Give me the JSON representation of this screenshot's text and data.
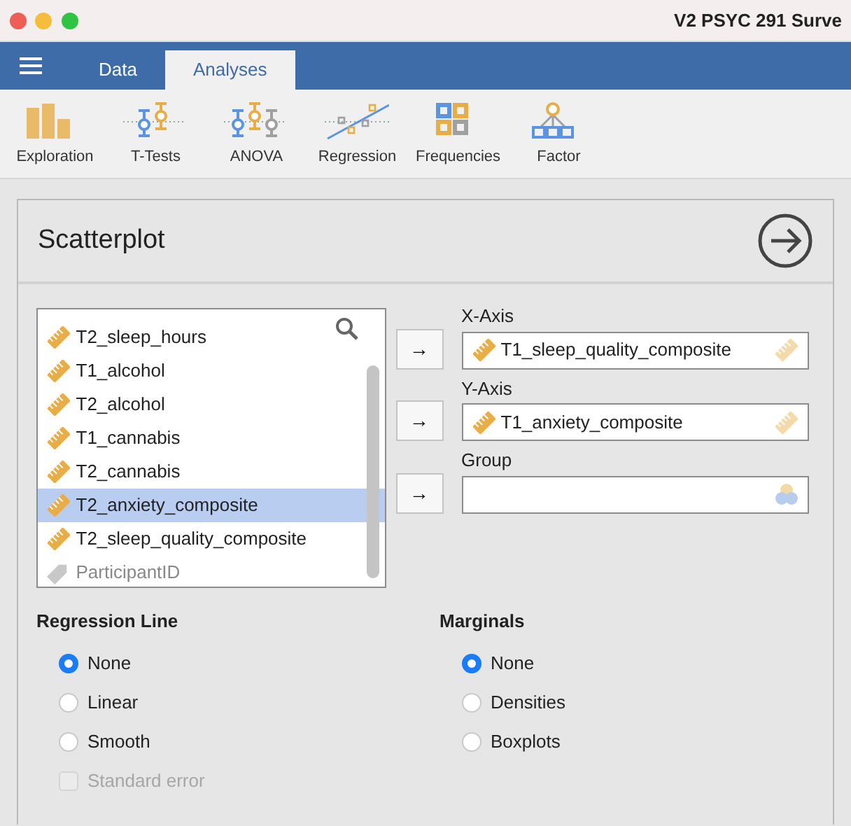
{
  "window": {
    "title": "V2 PSYC 291 Surve"
  },
  "tabs": [
    {
      "label": "Data",
      "selected": false
    },
    {
      "label": "Analyses",
      "selected": true
    }
  ],
  "toolbar": [
    {
      "label": "Exploration",
      "kind": "bars"
    },
    {
      "label": "T-Tests",
      "kind": "ttest"
    },
    {
      "label": "ANOVA",
      "kind": "anova"
    },
    {
      "label": "Regression",
      "kind": "regression"
    },
    {
      "label": "Frequencies",
      "kind": "frequencies"
    },
    {
      "label": "Factor",
      "kind": "factor"
    }
  ],
  "panel": {
    "title": "Scatterplot"
  },
  "variables": [
    {
      "name": "T2_sleep_hours",
      "kind": "continuous",
      "selected": false
    },
    {
      "name": "T1_alcohol",
      "kind": "continuous",
      "selected": false
    },
    {
      "name": "T2_alcohol",
      "kind": "continuous",
      "selected": false
    },
    {
      "name": "T1_cannabis",
      "kind": "continuous",
      "selected": false
    },
    {
      "name": "T2_cannabis",
      "kind": "continuous",
      "selected": false
    },
    {
      "name": "T2_anxiety_composite",
      "kind": "continuous",
      "selected": true
    },
    {
      "name": "T2_sleep_quality_composite",
      "kind": "continuous",
      "selected": false
    },
    {
      "name": "ParticipantID",
      "kind": "id",
      "selected": false
    }
  ],
  "targets": [
    {
      "label": "X-Axis",
      "value": "T1_sleep_quality_composite",
      "kind": "continuous"
    },
    {
      "label": "Y-Axis",
      "value": "T1_anxiety_composite",
      "kind": "continuous"
    },
    {
      "label": "Group",
      "kind": "nominal"
    }
  ],
  "arrow": "→",
  "options": [
    {
      "heading": "Regression Line",
      "choices": [
        {
          "label": "None",
          "selected": true
        },
        {
          "label": "Linear",
          "selected": false
        },
        {
          "label": "Smooth",
          "selected": false
        }
      ],
      "checkbox": {
        "label": "Standard error",
        "checked": false,
        "disabled": true
      }
    },
    {
      "heading": "Marginals",
      "choices": [
        {
          "label": "None",
          "selected": true
        },
        {
          "label": "Densities",
          "selected": false
        },
        {
          "label": "Boxplots",
          "selected": false
        }
      ]
    }
  ]
}
